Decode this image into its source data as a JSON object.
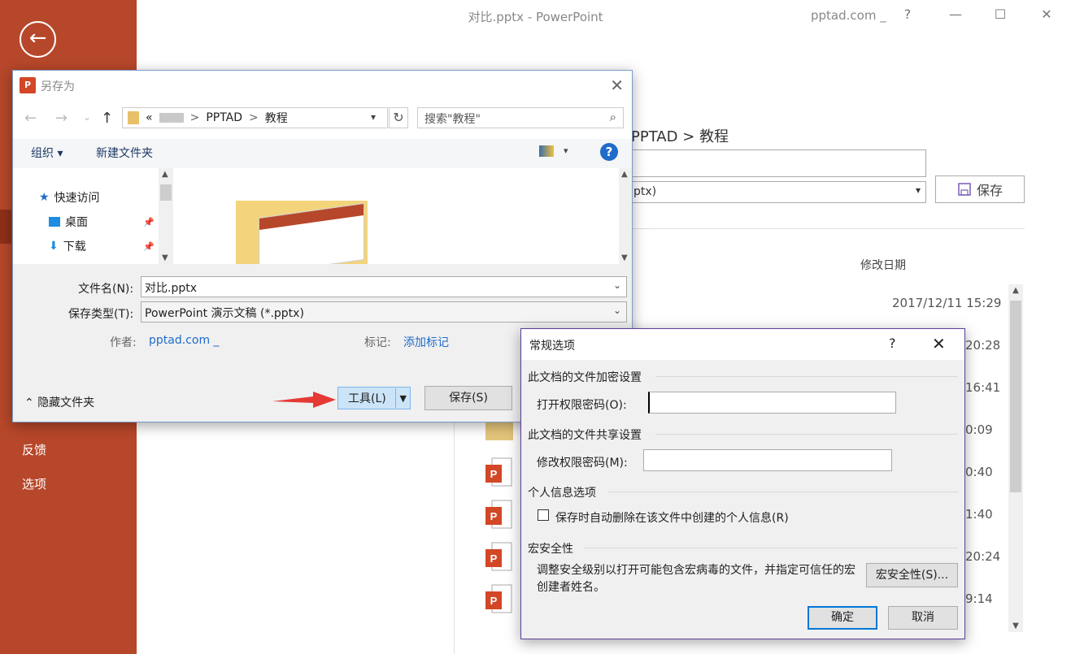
{
  "window": {
    "title": "对比.pptx  -  PowerPoint",
    "account": "pptad.com _",
    "help": "?",
    "minimize": "—",
    "maximize": "☐",
    "close": "✕"
  },
  "sidebar": {
    "back_icon": "←",
    "items": [
      {
        "label": "反馈"
      },
      {
        "label": "选项"
      }
    ]
  },
  "backstage": {
    "path": "PPTAD > 教程",
    "type_partial": "ptx)",
    "save_label": "保存",
    "col_header": "修改日期",
    "dates": [
      "2017/12/11 15:29",
      "20:28",
      "16:41",
      "0:09",
      "0:40",
      "1:40",
      "20:24",
      "9:14"
    ]
  },
  "saveas": {
    "title": "另存为",
    "app_icon": "P",
    "close": "✕",
    "nav": {
      "back": "←",
      "forward": "→",
      "down": "⌄",
      "up": "↑"
    },
    "address": {
      "chevrons": "«",
      "seg1": "PPTAD",
      "sep": ">",
      "seg2": "教程"
    },
    "refresh": "↻",
    "search_placeholder": "搜索\"教程\"",
    "search_icon": "⌕",
    "toolbar": {
      "organize": "组织 ▾",
      "new_folder": "新建文件夹",
      "view_dd": "▾",
      "help": "?"
    },
    "tree": [
      {
        "label": "快速访问"
      },
      {
        "label": "桌面"
      },
      {
        "label": "下载"
      }
    ],
    "filename_label": "文件名(N):",
    "filename_value": "对比.pptx",
    "filetype_label": "保存类型(T):",
    "filetype_value": "PowerPoint 演示文稿 (*.pptx)",
    "author_label": "作者:",
    "author_value": "pptad.com _",
    "tags_label": "标记:",
    "tags_value": "添加标记",
    "hide_folders": "隐藏文件夹",
    "tools_label": "工具(L)",
    "save_label": "保存(S)"
  },
  "general_options": {
    "title": "常规选项",
    "help": "?",
    "close": "✕",
    "encrypt_section": "此文档的文件加密设置",
    "open_pwd_label": "打开权限密码(O):",
    "share_section": "此文档的文件共享设置",
    "modify_pwd_label": "修改权限密码(M):",
    "privacy_section": "个人信息选项",
    "privacy_checkbox": "保存时自动删除在该文件中创建的个人信息(R)",
    "privacy_checked": false,
    "macro_section": "宏安全性",
    "macro_desc": "调整安全级别以打开可能包含宏病毒的文件，并指定可信任的宏创建者姓名。",
    "macro_btn": "宏安全性(S)...",
    "ok": "确定",
    "cancel": "取消"
  },
  "colors": {
    "ppt_red": "#b7472a",
    "link_blue": "#1f6cc9",
    "arrow_red": "#e53935",
    "dialog_border": "#5a3f99"
  }
}
